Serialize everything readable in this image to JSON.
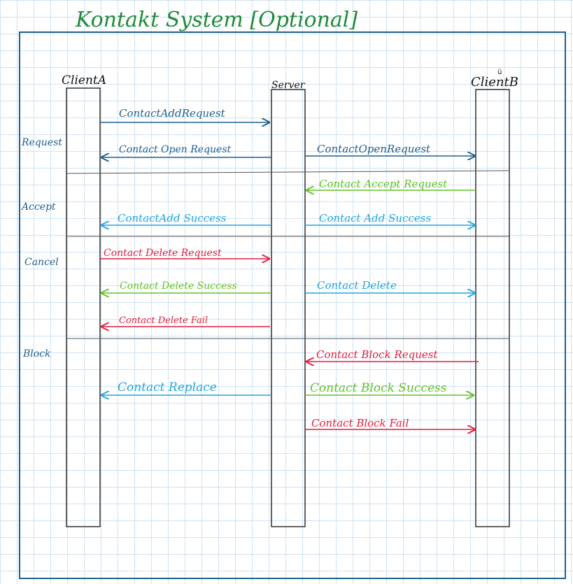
{
  "page_title": "Kontakt System [Optional]",
  "colors": {
    "title": "#1f8b3b",
    "frame": "#1f5e8c",
    "dark_blue": "#1f5e8c",
    "light_blue": "#21a6dd",
    "green": "#63c225",
    "red": "#e01f3d",
    "black": "#111111"
  },
  "participants": {
    "client_a": "ClientA",
    "server": "Server",
    "client_b": "ClientB"
  },
  "phases": {
    "request": "Request",
    "accept": "Accept",
    "cancel": "Cancel",
    "block": "Block"
  },
  "messages": {
    "contact_add_request": "ContactAddRequest",
    "contact_open_request_to_a": "Contact Open Request",
    "contact_open_request_to_b": "ContactOpenRequest",
    "contact_accept_request": "Contact Accept Request",
    "contact_add_success_to_a": "ContactAdd Success",
    "contact_add_success_to_b": "Contact Add Success",
    "contact_delete_request": "Contact Delete Request",
    "contact_delete_success": "Contact Delete Success",
    "contact_delete": "Contact Delete",
    "contact_delete_fail": "Contact Delete Fail",
    "contact_block_request": "Contact Block Request",
    "contact_replace": "Contact Replace",
    "contact_block_success": "Contact Block Success",
    "contact_block_fail": "Contact Block Fail"
  }
}
